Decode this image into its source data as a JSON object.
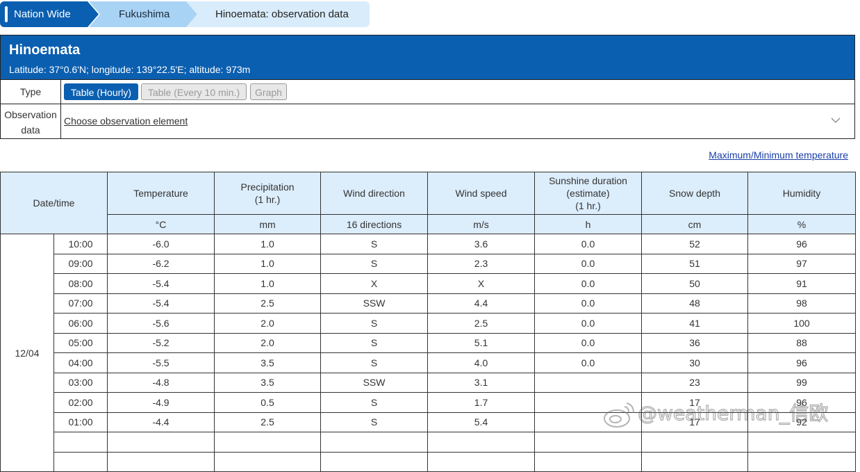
{
  "breadcrumb": {
    "items": [
      "Nation Wide",
      "Fukushima",
      "Hinoemata: observation data"
    ]
  },
  "station": {
    "name": "Hinoemata",
    "coords": "Latitude: 37°0.6'N; longitude: 139°22.5'E; altitude: 973m"
  },
  "type_row": {
    "label": "Type",
    "buttons": [
      "Table (Hourly)",
      "Table (Every 10 min.)",
      "Graph"
    ],
    "active": "Table (Hourly)"
  },
  "obs_row": {
    "label": "Observation\ndata",
    "select_text": "Choose observation element"
  },
  "maxmin_link": "Maximum/Minimum temperature",
  "table": {
    "datetime_header": "Date/time",
    "columns": [
      {
        "header": "Temperature",
        "unit": "°C"
      },
      {
        "header": "Precipitation\n(1 hr.)",
        "unit": "mm"
      },
      {
        "header": "Wind direction",
        "unit": "16 directions"
      },
      {
        "header": "Wind speed",
        "unit": "m/s"
      },
      {
        "header": "Sunshine duration\n(estimate)\n(1 hr.)",
        "unit": "h"
      },
      {
        "header": "Snow depth",
        "unit": "cm"
      },
      {
        "header": "Humidity",
        "unit": "%"
      }
    ],
    "date": "12/04",
    "rows": [
      {
        "time": "10:00",
        "temp": "-6.0",
        "precip": "1.0",
        "wdir": "S",
        "wspeed": "3.6",
        "sun": "0.0",
        "snow": "52",
        "hum": "96"
      },
      {
        "time": "09:00",
        "temp": "-6.2",
        "precip": "1.0",
        "wdir": "S",
        "wspeed": "2.3",
        "sun": "0.0",
        "snow": "51",
        "hum": "97"
      },
      {
        "time": "08:00",
        "temp": "-5.4",
        "precip": "1.0",
        "wdir": "X",
        "wspeed": "X",
        "sun": "0.0",
        "snow": "50",
        "hum": "91"
      },
      {
        "time": "07:00",
        "temp": "-5.4",
        "precip": "2.5",
        "wdir": "SSW",
        "wspeed": "4.4",
        "sun": "0.0",
        "snow": "48",
        "hum": "98"
      },
      {
        "time": "06:00",
        "temp": "-5.6",
        "precip": "2.0",
        "wdir": "S",
        "wspeed": "2.5",
        "sun": "0.0",
        "snow": "41",
        "hum": "100"
      },
      {
        "time": "05:00",
        "temp": "-5.2",
        "precip": "2.0",
        "wdir": "S",
        "wspeed": "5.1",
        "sun": "0.0",
        "snow": "36",
        "hum": "88"
      },
      {
        "time": "04:00",
        "temp": "-5.5",
        "precip": "3.5",
        "wdir": "S",
        "wspeed": "4.0",
        "sun": "0.0",
        "snow": "30",
        "hum": "96"
      },
      {
        "time": "03:00",
        "temp": "-4.8",
        "precip": "3.5",
        "wdir": "SSW",
        "wspeed": "3.1",
        "sun": "",
        "snow": "23",
        "hum": "99"
      },
      {
        "time": "02:00",
        "temp": "-4.9",
        "precip": "0.5",
        "wdir": "S",
        "wspeed": "1.7",
        "sun": "",
        "snow": "17",
        "hum": "96"
      },
      {
        "time": "01:00",
        "temp": "-4.4",
        "precip": "2.5",
        "wdir": "S",
        "wspeed": "5.4",
        "sun": "",
        "snow": "17",
        "hum": "92"
      }
    ]
  },
  "watermark": "@weatherman_信欧",
  "colors": {
    "primary": "#0b5fb0",
    "header_bg": "#dcedfb",
    "crumb_mid": "#a9d3f5",
    "crumb_light": "#d9ecfb",
    "link": "#1a3ea8"
  }
}
